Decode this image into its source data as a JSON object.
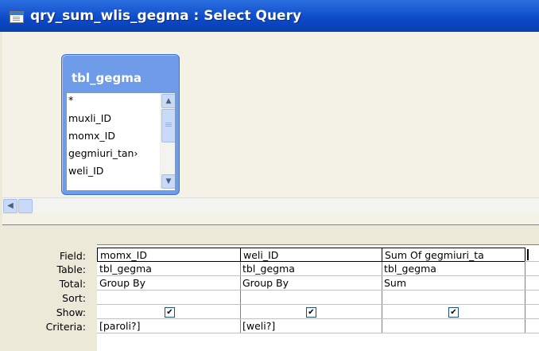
{
  "window": {
    "title": "qry_sum_wlis_gegma : Select Query",
    "icon": "query-window-icon"
  },
  "table_box": {
    "name": "tbl_gegma",
    "fields": [
      "*",
      "muxli_ID",
      "momx_ID",
      "gegmiuri_tan›",
      "weli_ID"
    ]
  },
  "row_labels": [
    "Field:",
    "Table:",
    "Total:",
    "Sort:",
    "Show:",
    "Criteria:"
  ],
  "columns": [
    {
      "field": "momx_ID",
      "table": "tbl_gegma",
      "total": "Group By",
      "sort": "",
      "show": true,
      "criteria": "[paroli?]"
    },
    {
      "field": "weli_ID",
      "table": "tbl_gegma",
      "total": "Group By",
      "sort": "",
      "show": true,
      "criteria": "[weli?]"
    },
    {
      "field": "Sum Of gegmiuri_ta",
      "table": "tbl_gegma",
      "total": "Sum",
      "sort": "",
      "show": true,
      "criteria": ""
    }
  ]
}
